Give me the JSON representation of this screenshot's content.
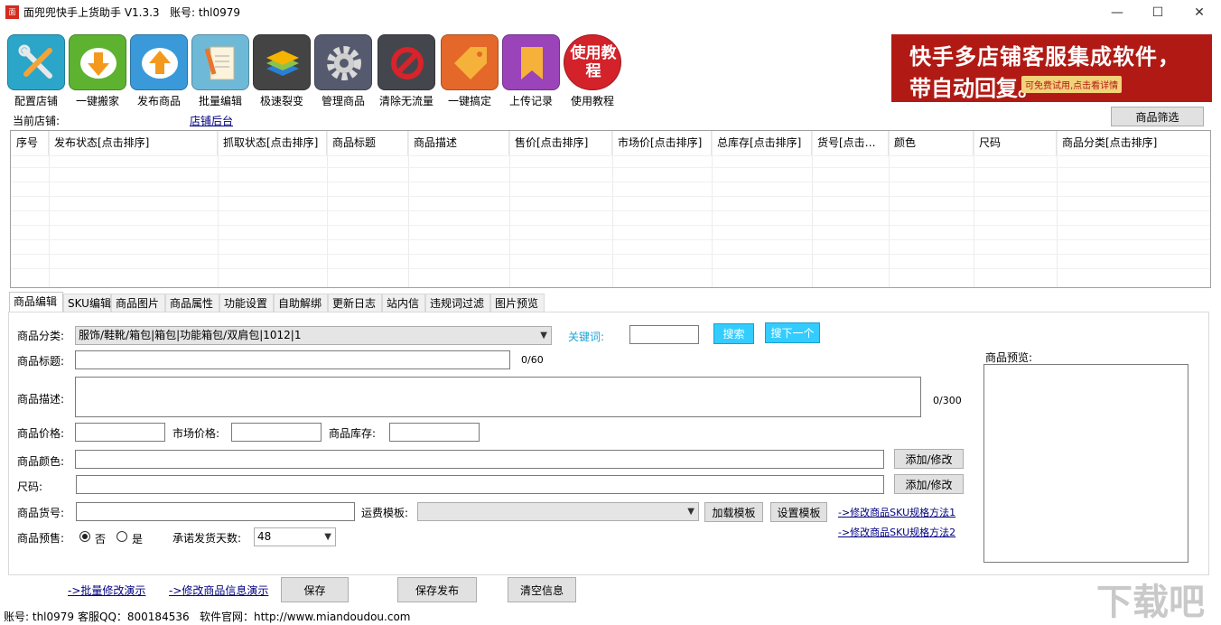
{
  "window": {
    "app_icon_text": "面兜",
    "title": "面兜兜快手上货助手 V1.3.3",
    "account_label": "账号: thl0979",
    "minimize": "—",
    "maximize": "☐",
    "close": "✕"
  },
  "toolbar": [
    {
      "label": "配置店铺",
      "icon": "wrench-screwdriver-icon",
      "color": "#2ba6c9"
    },
    {
      "label": "一键搬家",
      "icon": "download-cloud-icon",
      "color": "#5db330"
    },
    {
      "label": "发布商品",
      "icon": "upload-cloud-icon",
      "color": "#3a9ad9"
    },
    {
      "label": "批量编辑",
      "icon": "document-pencil-icon",
      "color": "#6fb9d8"
    },
    {
      "label": "极速裂变",
      "icon": "layers-icon",
      "color": "#444444"
    },
    {
      "label": "管理商品",
      "icon": "gear-icon",
      "color": "#555a6e"
    },
    {
      "label": "清除无流量",
      "icon": "no-entry-icon",
      "color": "#44464d"
    },
    {
      "label": "一键搞定",
      "icon": "tag-icon",
      "color": "#e4682a"
    },
    {
      "label": "上传记录",
      "icon": "bookmark-icon",
      "color": "#9b43b8"
    },
    {
      "label": "使用教程",
      "icon": "tutorial-badge-icon",
      "color": "#d3222a",
      "text": "使用教程"
    }
  ],
  "banner": {
    "line1": "快手多店铺客服集成软件，",
    "line2": "带自动回复。",
    "tag": "可免费试用,点击看详情"
  },
  "store": {
    "current_label": "当前店铺:",
    "backend_link": "店铺后台",
    "filter_button": "商品筛选"
  },
  "table": {
    "columns": [
      "序号",
      "发布状态[点击排序]",
      "抓取状态[点击排序]",
      "商品标题",
      "商品描述",
      "售价[点击排序]",
      "市场价[点击排序]",
      "总库存[点击排序]",
      "货号[点击…",
      "颜色",
      "尺码",
      "商品分类[点击排序]"
    ],
    "rows": []
  },
  "tabs": [
    "商品编辑",
    "SKU编辑",
    "商品图片",
    "商品属性",
    "功能设置",
    "自助解绑",
    "更新日志",
    "站内信",
    "违规词过滤",
    "图片预览"
  ],
  "form": {
    "category_label": "商品分类:",
    "category_value": "服饰/鞋靴/箱包|箱包|功能箱包/双肩包|1012|1",
    "keyword_label": "关键词:",
    "keyword_value": "",
    "search_button": "搜索",
    "search_next_button": "搜下一个",
    "title_label": "商品标题:",
    "title_value": "",
    "title_counter": "0/60",
    "desc_label": "商品描述:",
    "desc_value": "",
    "desc_counter": "0/300",
    "price_label": "商品价格:",
    "price_value": "",
    "market_price_label": "市场价格:",
    "market_price_value": "",
    "stock_label": "商品库存:",
    "stock_value": "",
    "color_label": "商品颜色:",
    "color_value": "",
    "color_button": "添加/修改",
    "size_label": "尺码:",
    "size_value": "",
    "size_button": "添加/修改",
    "sku_label": "商品货号:",
    "sku_value": "",
    "shipping_label": "运费模板:",
    "shipping_value": "",
    "load_template_button": "加载模板",
    "set_template_button": "设置模板",
    "sku_method1_link": "->修改商品SKU规格方法1",
    "sku_method2_link": "->修改商品SKU规格方法2",
    "presale_label": "商品预售:",
    "presale_no": "否",
    "presale_yes": "是",
    "ship_days_label": "承诺发货天数:",
    "ship_days_value": "48",
    "preview_label": "商品预览:"
  },
  "bottom": {
    "batch_demo_link": "->批量修改演示",
    "edit_demo_link": "->修改商品信息演示",
    "save_button": "保存",
    "save_publish_button": "保存发布",
    "clear_button": "清空信息"
  },
  "status": {
    "account": "账号: thl0979",
    "qq": "客服QQ：800184536",
    "website": "软件官网：http://www.miandoudou.com"
  },
  "watermark": "下载吧",
  "colors": {
    "accent": "#33ccff",
    "link": "#000080",
    "keyword": "#1aa3d9"
  }
}
